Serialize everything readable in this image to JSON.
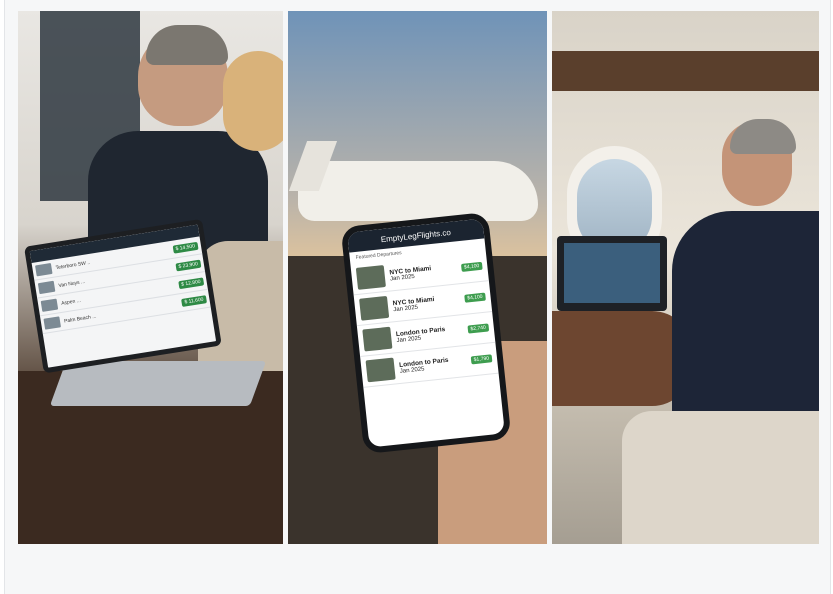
{
  "collage": {
    "panels": [
      "laptop-meeting",
      "phone-at-airfield",
      "cabin-call"
    ]
  },
  "laptop_screen": {
    "rows": [
      {
        "route": "Teterboro SW ..",
        "price": "$ 14,500"
      },
      {
        "route": "Van Nuys ...",
        "price": "$ 23,900"
      },
      {
        "route": "Aspen ...",
        "price": "$ 12,800"
      },
      {
        "route": "Palm Beach ...",
        "price": "$ 11,600"
      }
    ]
  },
  "phone_app": {
    "title": "EmptyLegFlights.co",
    "subtitle": "Featured Departures",
    "listings": [
      {
        "route": "NYC to Miami",
        "date": "Jan 2025",
        "price": "$4,100"
      },
      {
        "route": "NYC to Miami",
        "date": "Jan 2025",
        "price": "$4,100"
      },
      {
        "route": "London to Paris",
        "date": "Jan 2025",
        "price": "$2,740"
      },
      {
        "route": "London to Paris",
        "date": "Jan 2025",
        "price": "$1,790"
      }
    ]
  }
}
